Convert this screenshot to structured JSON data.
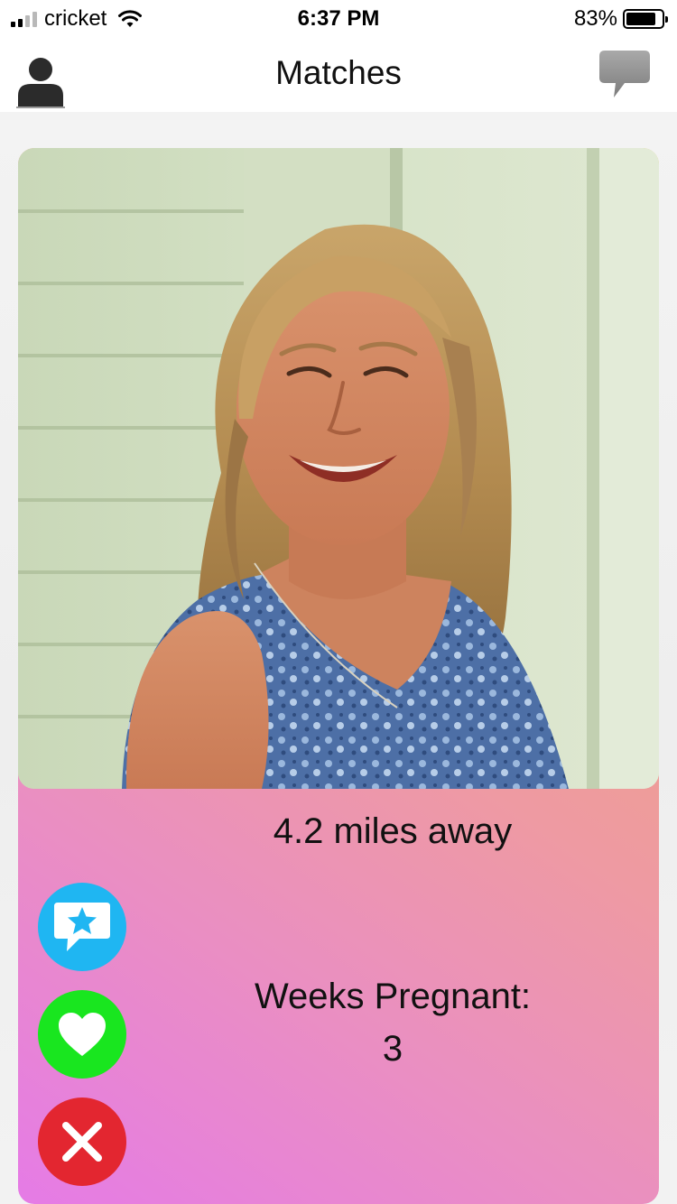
{
  "status_bar": {
    "carrier": "cricket",
    "time": "6:37 PM",
    "battery_percent": "83%",
    "battery_level": 0.83,
    "signal_bars_filled": 2,
    "signal_bars_total": 4
  },
  "nav": {
    "title": "Matches",
    "left_icon": "profile-icon",
    "right_icon": "chat-bubble-icon"
  },
  "card": {
    "photo_icon": "profile-photo",
    "distance": "4.2 miles away",
    "weeks_label": "Weeks Pregnant:",
    "weeks_value": "3"
  },
  "actions": [
    {
      "icon": "star-message-icon",
      "color": "#1fb6f2"
    },
    {
      "icon": "heart-icon",
      "color": "#19e61f"
    },
    {
      "icon": "close-icon",
      "color": "#e32630"
    }
  ]
}
